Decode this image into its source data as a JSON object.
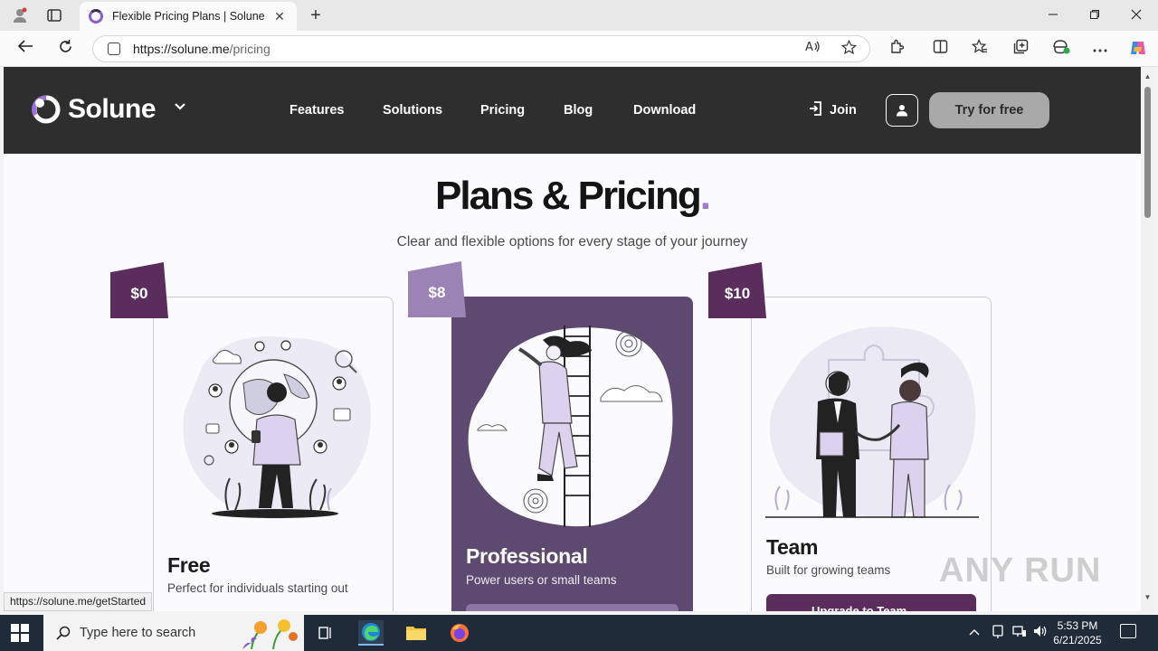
{
  "browser": {
    "tab_title": "Flexible Pricing Plans | Solune",
    "url_host": "https://solune.me",
    "url_path": "/pricing",
    "tab_close_glyph": "✕",
    "new_tab_glyph": "+"
  },
  "site": {
    "logo_text": "Solune",
    "nav": [
      "Features",
      "Solutions",
      "Pricing",
      "Blog",
      "Download"
    ],
    "join_label": "Join",
    "try_label": "Try for free"
  },
  "hero": {
    "title": "Plans & Pricing",
    "title_dot": ".",
    "subtitle": "Clear and flexible options for every stage of your journey"
  },
  "plans": [
    {
      "price": "$0",
      "name": "Free",
      "desc": "Perfect for individuals starting out"
    },
    {
      "price": "$8",
      "name": "Professional",
      "desc": "Power users or small teams"
    },
    {
      "price": "$10",
      "name": "Team",
      "desc": "Built for growing teams",
      "button": "Upgrade to Team"
    }
  ],
  "status_bar_url": "https://solune.me/getStarted",
  "watermark": "ANY RUN",
  "taskbar": {
    "search_placeholder": "Type here to search",
    "time": "5:53 PM",
    "date": "6/21/2025"
  },
  "colors": {
    "nav_bg": "#2e2e2e",
    "accent_purple": "#5e4a70",
    "tag_dark": "#5a2d5c",
    "tag_light": "#9c83b5",
    "title_dot": "#a07ad6"
  }
}
